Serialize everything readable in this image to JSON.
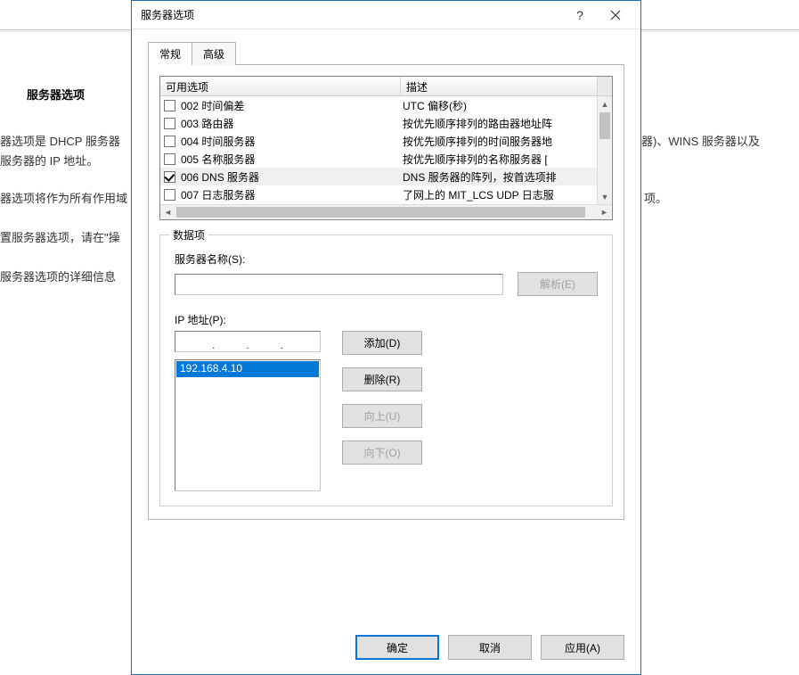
{
  "background": {
    "heading": "服务器选项",
    "line1": "器选项是 DHCP 服务器",
    "line1_right": "器)、WINS 服务器以及",
    "line2": "服务器的 IP 地址。",
    "line3": "器选项将作为所有作用域",
    "line3_right": "项。",
    "line4": "置服务器选项，请在\"操",
    "line5": "服务器选项的详细信息"
  },
  "dialog": {
    "title": "服务器选项",
    "help_tip": "?",
    "tabs": {
      "general": "常规",
      "advanced": "高级"
    },
    "list": {
      "col_name": "可用选项",
      "col_desc": "描述",
      "rows": [
        {
          "checked": false,
          "name": "002 时间偏差",
          "desc": "UTC 偏移(秒)"
        },
        {
          "checked": false,
          "name": "003 路由器",
          "desc": "按优先顺序排列的路由器地址阵"
        },
        {
          "checked": false,
          "name": "004 时间服务器",
          "desc": "按优先顺序排列的时间服务器地"
        },
        {
          "checked": false,
          "name": "005 名称服务器",
          "desc": "按优先顺序排列的名称服务器 ["
        },
        {
          "checked": true,
          "name": "006 DNS 服务器",
          "desc": "DNS 服务器的阵列，按首选项排"
        },
        {
          "checked": false,
          "name": "007 日志服务器",
          "desc": "了网上的 MIT_LCS UDP 日志服"
        }
      ]
    },
    "group": {
      "legend": "数据项",
      "server_name_label": "服务器名称(S):",
      "server_name_value": "",
      "resolve_btn": "解析(E)",
      "ip_label": "IP 地址(P):",
      "add_btn": "添加(D)",
      "remove_btn": "删除(R)",
      "up_btn": "向上(U)",
      "down_btn": "向下(O)",
      "ip_list": [
        "192.168.4.10"
      ]
    },
    "footer": {
      "ok": "确定",
      "cancel": "取消",
      "apply": "应用(A)"
    }
  }
}
